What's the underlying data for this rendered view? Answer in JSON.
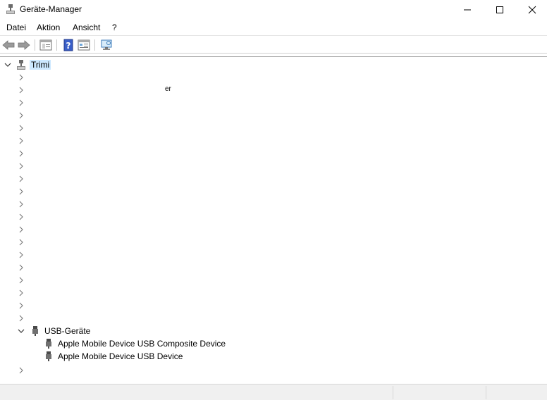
{
  "window": {
    "title": "Geräte-Manager"
  },
  "menu": {
    "items": [
      "Datei",
      "Aktion",
      "Ansicht",
      "?"
    ]
  },
  "toolbar": {
    "buttons": [
      "back-arrow-icon",
      "forward-arrow-icon",
      "properties-icon",
      "help-icon",
      "update-driver-icon",
      "scan-hardware-icon"
    ]
  },
  "tree": {
    "root": "Trimi",
    "fragment": "er",
    "usb_category": "USB-Geräte",
    "usb_children": [
      "Apple Mobile Device USB Composite Device",
      "Apple Mobile Device USB Device"
    ]
  },
  "colors": {
    "selection": "#cce8ff",
    "help_icon": "#3a5fc8",
    "arrows": "#7a7a7a"
  }
}
